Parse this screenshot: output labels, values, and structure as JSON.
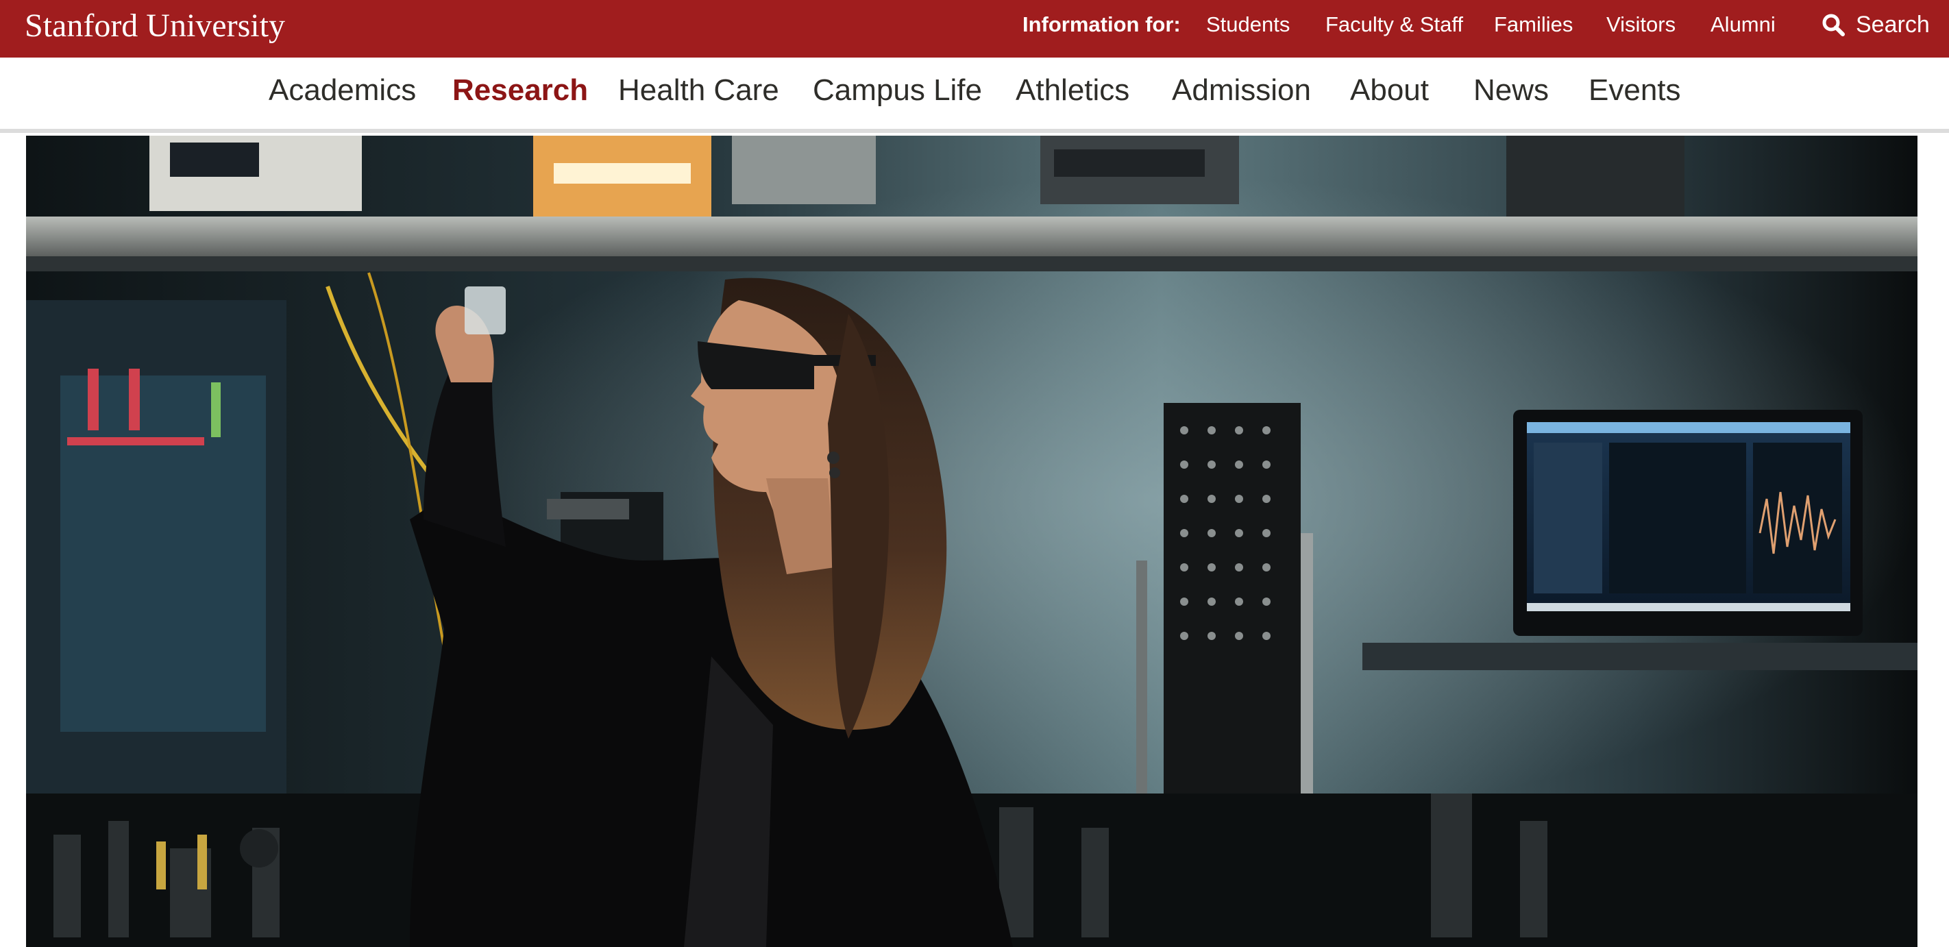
{
  "brand": {
    "name": "Stanford University"
  },
  "utility_nav": {
    "label": "Information for:",
    "items": [
      {
        "label": "Students"
      },
      {
        "label": "Faculty & Staff"
      },
      {
        "label": "Families"
      },
      {
        "label": "Visitors"
      },
      {
        "label": "Alumni"
      }
    ],
    "search_label": "Search"
  },
  "main_nav": {
    "active": "Research",
    "items": [
      {
        "label": "Academics"
      },
      {
        "label": "Research"
      },
      {
        "label": "Health Care"
      },
      {
        "label": "Campus Life"
      },
      {
        "label": "Athletics"
      },
      {
        "label": "Admission"
      },
      {
        "label": "About"
      },
      {
        "label": "News"
      },
      {
        "label": "Events"
      }
    ]
  },
  "hero": {
    "icon": "photo-researcher-lab"
  },
  "colors": {
    "brand_bar": "#a01d1e",
    "active_nav": "#8c1515",
    "nav_text": "#2e2d29"
  }
}
